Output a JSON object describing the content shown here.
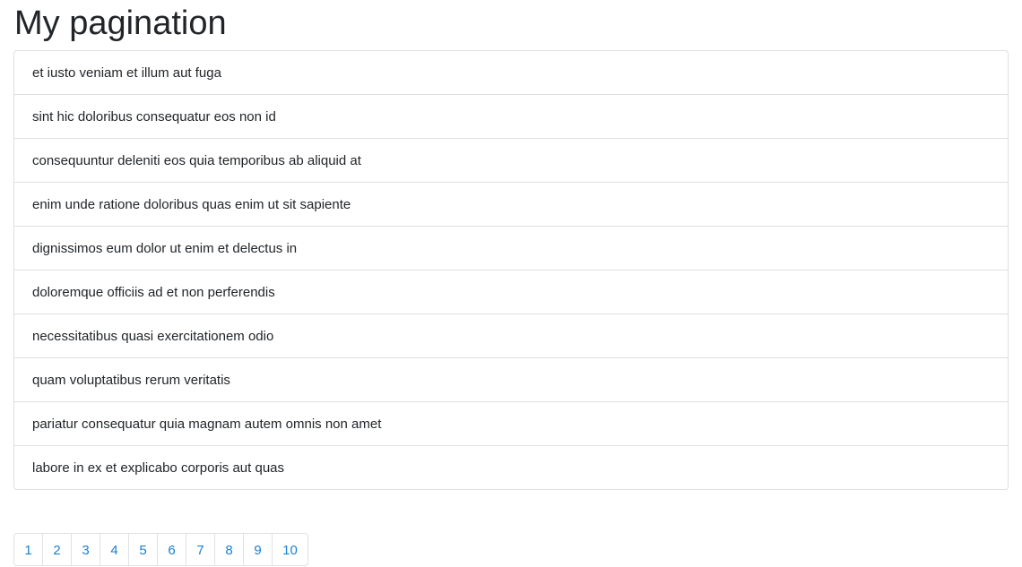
{
  "header": {
    "title": "My pagination"
  },
  "list": {
    "items": [
      "et iusto veniam et illum aut fuga",
      "sint hic doloribus consequatur eos non id",
      "consequuntur deleniti eos quia temporibus ab aliquid at",
      "enim unde ratione doloribus quas enim ut sit sapiente",
      "dignissimos eum dolor ut enim et delectus in",
      "doloremque officiis ad et non perferendis",
      "necessitatibus quasi exercitationem odio",
      "quam voluptatibus rerum veritatis",
      "pariatur consequatur quia magnam autem omnis non amet",
      "labore in ex et explicabo corporis aut quas"
    ]
  },
  "pagination": {
    "pages": [
      "1",
      "2",
      "3",
      "4",
      "5",
      "6",
      "7",
      "8",
      "9",
      "10"
    ],
    "link_color": "#1a7fd4"
  }
}
